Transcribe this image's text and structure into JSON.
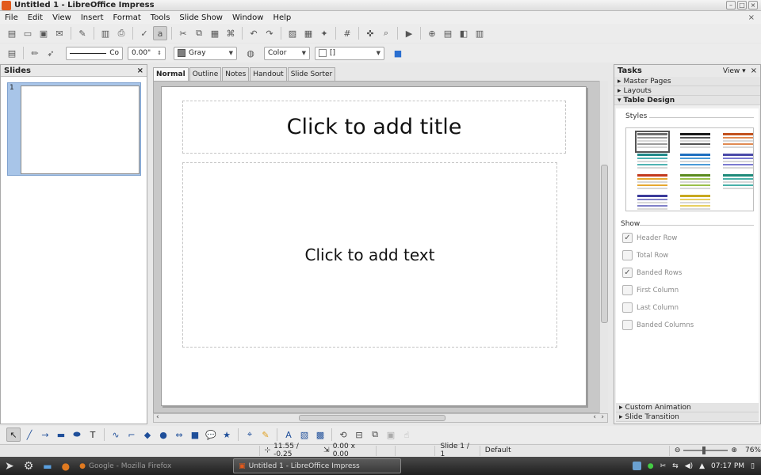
{
  "window": {
    "title": "Untitled 1 - LibreOffice Impress"
  },
  "menu": [
    "File",
    "Edit",
    "View",
    "Insert",
    "Format",
    "Tools",
    "Slide Show",
    "Window",
    "Help"
  ],
  "toolbar2": {
    "line_style": "Co",
    "angle": "0.00\"",
    "area_color": "Gray",
    "area_style": "Color",
    "area_fill": "[]"
  },
  "slides_pane": {
    "title": "Slides",
    "slide_number": "1"
  },
  "view_tabs": [
    "Normal",
    "Outline",
    "Notes",
    "Handout",
    "Slide Sorter"
  ],
  "slide": {
    "title_placeholder": "Click to add title",
    "text_placeholder": "Click to add text"
  },
  "tasks": {
    "title": "Tasks",
    "view_label": "View",
    "sections_top": [
      "Master Pages",
      "Layouts",
      "Table Design"
    ],
    "styles_label": "Styles",
    "show_label": "Show",
    "options": [
      {
        "label": "Header Row",
        "checked": true
      },
      {
        "label": "Total Row",
        "checked": false
      },
      {
        "label": "Banded Rows",
        "checked": true
      },
      {
        "label": "First Column",
        "checked": false
      },
      {
        "label": "Last Column",
        "checked": false
      },
      {
        "label": "Banded Columns",
        "checked": false
      }
    ],
    "sections_bottom": [
      "Custom Animation",
      "Slide Transition"
    ],
    "table_styles": [
      {
        "head": "#6e6e6e",
        "row": "#9a9a9a"
      },
      {
        "head": "#1a1a1a",
        "row": "#555555"
      },
      {
        "head": "#c2521e",
        "row": "#e08a52"
      },
      {
        "head": "#1f8a8a",
        "row": "#4fb3b3"
      },
      {
        "head": "#1e6fbf",
        "row": "#4a9ad8"
      },
      {
        "head": "#4a4aa8",
        "row": "#7a7ad0"
      },
      {
        "head": "#c23a1e",
        "row": "#e6a830"
      },
      {
        "head": "#5a8a1e",
        "row": "#9ac04a"
      },
      {
        "head": "#1e8a7a",
        "row": "#48b0a8"
      },
      {
        "head": "#3a3a9a",
        "row": "#8080c8"
      },
      {
        "head": "#c8a81e",
        "row": "#e8d060"
      }
    ]
  },
  "status": {
    "position": "11.55 / -0.25",
    "size": "0.00 x 0.00",
    "slide": "Slide 1 / 1",
    "layout": "Default",
    "zoom": "76%"
  },
  "taskbar": {
    "firefox_task": "Google - Mozilla Firefox",
    "impress_task": "Untitled 1 - LibreOffice Impress",
    "clock": "07:17 PM"
  }
}
